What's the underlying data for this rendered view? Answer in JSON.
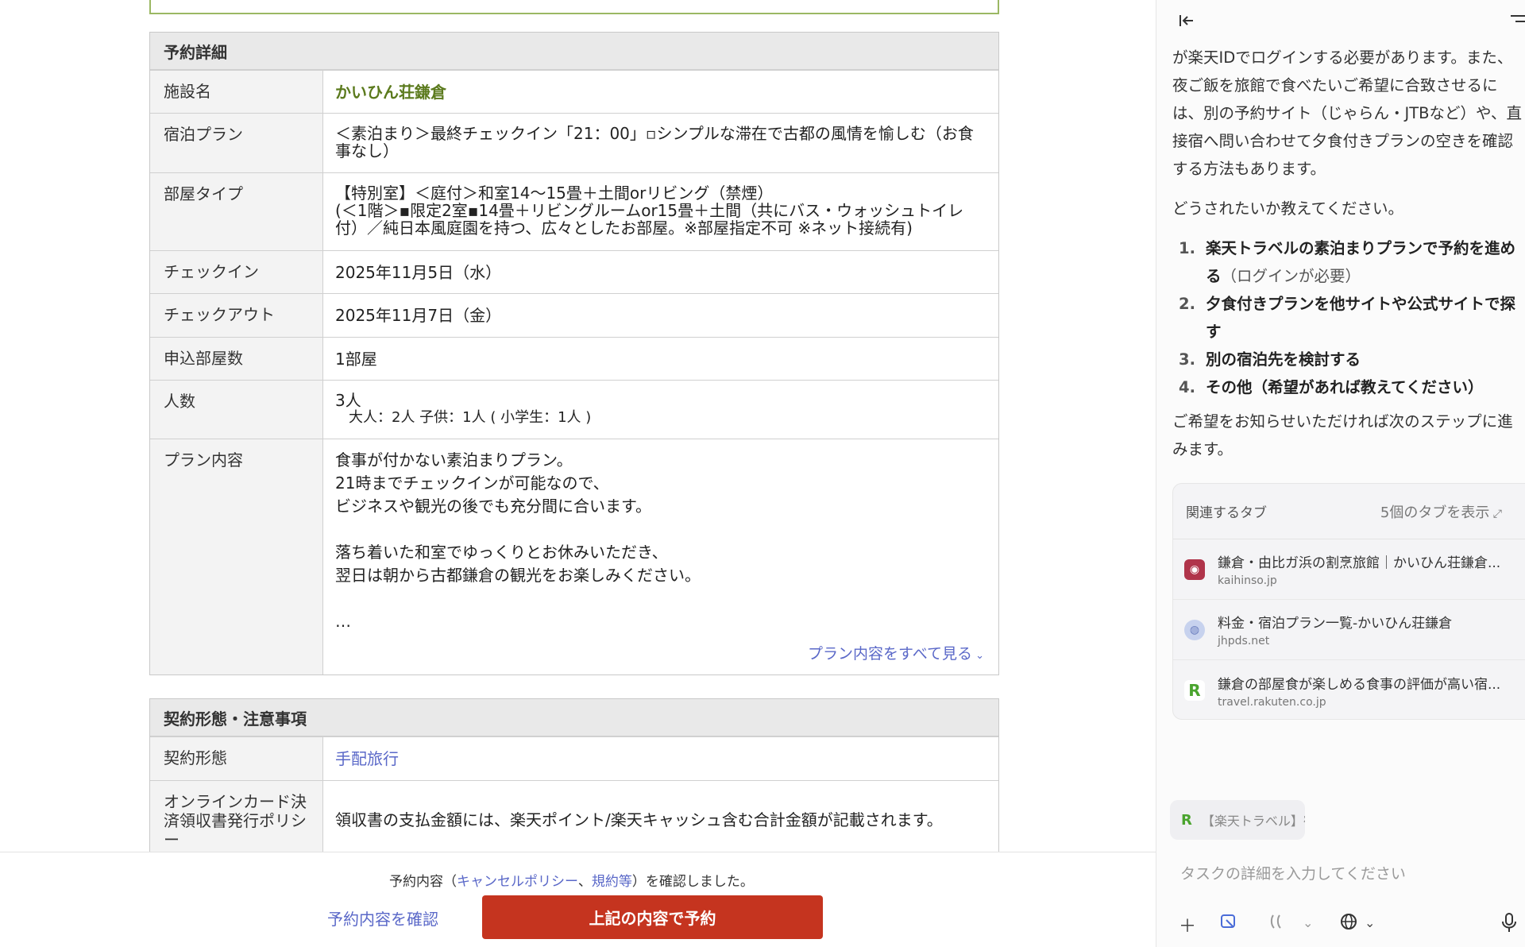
{
  "reservation": {
    "header": "予約詳細",
    "rows": [
      {
        "label": "施設名",
        "value": "かいひん荘鎌倉"
      },
      {
        "label": "宿泊プラン",
        "value": "＜素泊まり＞最終チェックイン「21：00」▫シンプルな滞在で古都の風情を愉しむ（お食事なし）"
      },
      {
        "label": "部屋タイプ",
        "value_lines": [
          "【特別室】＜庭付＞和室14〜15畳＋土間orリビング（禁煙）",
          "(＜1階＞▪限定2室▪14畳＋リビングルームor15畳＋土間（共にバス・ウォッシュトイレ付）／純日本風庭園を持つ、広々としたお部屋。※部屋指定不可 ※ネット接続有)"
        ]
      },
      {
        "label": "チェックイン",
        "value": "2025年11月5日（水）"
      },
      {
        "label": "チェックアウト",
        "value": "2025年11月7日（金）"
      },
      {
        "label": "申込部屋数",
        "value": "1部屋"
      },
      {
        "label": "人数",
        "value": "3人",
        "sub": "大人：2人 子供：1人 ( 小学生：1人 )"
      },
      {
        "label": "プラン内容",
        "value_lines": [
          "食事が付かない素泊まりプラン。",
          "21時までチェックインが可能なので、",
          "ビジネスや観光の後でも充分間に合います。",
          "",
          "落ち着いた和室でゆっくりとお休みいただき、",
          "翌日は朝から古都鎌倉の観光をお楽しみください。",
          "",
          "…"
        ],
        "see_all": "プラン内容をすべて見る"
      }
    ]
  },
  "contract": {
    "header": "契約形態・注意事項",
    "rows": [
      {
        "label": "契約形態",
        "value": "手配旅行"
      },
      {
        "label": "オンラインカード決済領収書発行ポリシー",
        "value": "領収書の支払金額には、楽天ポイント/楽天キャッシュ含む合計金額が記載されます。"
      }
    ]
  },
  "footer": {
    "confirm_prefix": "予約内容（",
    "cancel_policy": "キャンセルポリシー",
    "separator": "、",
    "terms": "規約等",
    "confirm_suffix": "）を確認しました。",
    "confirm_button": "予約内容を確認",
    "reserve_button": "上記の内容で予約",
    "reserve_color": "#c5341f"
  },
  "assistant": {
    "messages": [
      "が楽天IDでログインする必要があります。また、夜ご飯を旅館で食べたいご希望に合致させるには、別の予約サイト（じゃらん・JTBなど）や、直接宿へ問い合わせて夕食付きプランの空きを確認する方法もあります。",
      "どうされたいか教えてください。"
    ],
    "options": [
      {
        "num": "1.",
        "text": "楽天トラベルの素泊まりプランで予約を進める",
        "note": "（ログインが必要）"
      },
      {
        "num": "2.",
        "text": "夕食付きプランを他サイトや公式サイトで探す",
        "note": ""
      },
      {
        "num": "3.",
        "text": "別の宿泊先を検討する",
        "note": ""
      },
      {
        "num": "4.",
        "text": "その他（希望があれば教えてください）",
        "note": ""
      }
    ],
    "closing": "ご希望をお知らせいただければ次のステップに進みます。",
    "related_tabs": {
      "label": "関連するタブ",
      "show": "5個のタブを表示",
      "items": [
        {
          "title": "鎌倉・由比ガ浜の割烹旅館｜かいひん荘鎌倉...",
          "domain": "kaihinso.jp",
          "icon": "kaihinso-favicon"
        },
        {
          "title": "料金・宿泊プラン一覧-かいひん荘鎌倉",
          "domain": "jhpds.net",
          "icon": "globe-favicon"
        },
        {
          "title": "鎌倉の部屋食が楽しめる食事の評価が高い宿...",
          "domain": "travel.rakuten.co.jp",
          "icon": "rakuten-favicon"
        }
      ]
    },
    "context_chip": "【楽天トラベル】宿",
    "input_placeholder": "タスクの詳細を入力してください"
  }
}
